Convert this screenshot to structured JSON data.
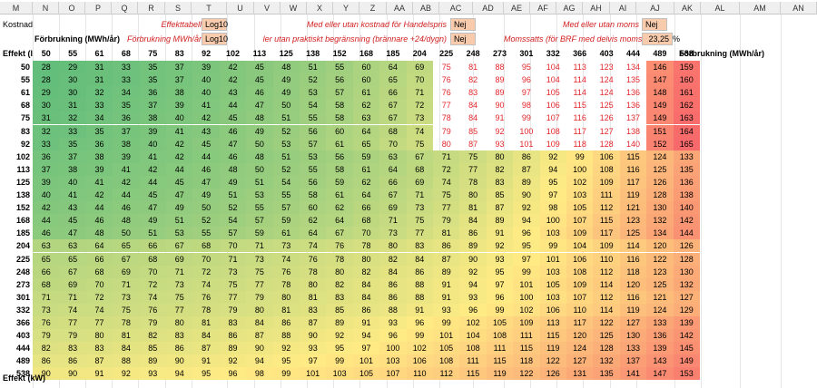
{
  "column_headers": [
    "M",
    "N",
    "O",
    "P",
    "Q",
    "R",
    "S",
    "T",
    "U",
    "V",
    "W",
    "X",
    "Y",
    "Z",
    "AA",
    "AB",
    "AC",
    "AD",
    "AE",
    "AF",
    "AG",
    "AH",
    "AI",
    "AJ",
    "AK",
    "AL",
    "AM",
    "AN"
  ],
  "labels": {
    "kostnad": "Kostnad",
    "forbrukning_bold": "Förbrukning (MWh/år)",
    "forbrukning_red": "Förbrukning MWh/år",
    "effekttabell": "Effekttabell",
    "log10_a": "Log10",
    "log10_b": "Log10",
    "handelspris_label": "Med eller utan kostnad för Handelspris",
    "handelspris_value": "Nej",
    "begransning_label": "ler utan praktiskt begränsning (brännare +24/dygn)",
    "begransning_value": "Nej",
    "moms_label": "Med eller utan moms",
    "moms_value": "Nej",
    "momssats_label": "Momssatts (för BRF med delvis moms)",
    "momssats_value": "23,25",
    "percent": "%",
    "effekt_corner": "Effekt (l",
    "forbrukning_right": "Förbrukning (MWh/år)",
    "effekt_kw": "Effekt (kW)"
  },
  "heatmap": {
    "col_headers": [
      "50",
      "55",
      "61",
      "68",
      "75",
      "83",
      "92",
      "102",
      "113",
      "125",
      "138",
      "152",
      "168",
      "185",
      "204",
      "225",
      "248",
      "273",
      "301",
      "332",
      "366",
      "403",
      "444",
      "489",
      "538"
    ],
    "row_headers": [
      "50",
      "55",
      "61",
      "68",
      "75",
      "83",
      "92",
      "102",
      "113",
      "125",
      "138",
      "152",
      "168",
      "185",
      "204",
      "225",
      "248",
      "273",
      "301",
      "332",
      "366",
      "403",
      "444",
      "489",
      "538"
    ],
    "rows": [
      [
        "28",
        "29",
        "31",
        "33",
        "35",
        "37",
        "39",
        "42",
        "45",
        "48",
        "51",
        "55",
        "60",
        "64",
        "69",
        "75",
        "81",
        "88",
        "95",
        "104",
        "113",
        "123",
        "134",
        "146",
        "159"
      ],
      [
        "28",
        "30",
        "31",
        "33",
        "35",
        "37",
        "40",
        "42",
        "45",
        "49",
        "52",
        "56",
        "60",
        "65",
        "70",
        "76",
        "82",
        "89",
        "96",
        "104",
        "114",
        "124",
        "135",
        "147",
        "160"
      ],
      [
        "29",
        "30",
        "32",
        "34",
        "36",
        "38",
        "40",
        "43",
        "46",
        "49",
        "53",
        "57",
        "61",
        "66",
        "71",
        "76",
        "83",
        "89",
        "97",
        "105",
        "114",
        "124",
        "136",
        "148",
        "161"
      ],
      [
        "30",
        "31",
        "33",
        "35",
        "37",
        "39",
        "41",
        "44",
        "47",
        "50",
        "54",
        "58",
        "62",
        "67",
        "72",
        "77",
        "84",
        "90",
        "98",
        "106",
        "115",
        "125",
        "136",
        "149",
        "162"
      ],
      [
        "31",
        "32",
        "34",
        "36",
        "38",
        "40",
        "42",
        "45",
        "48",
        "51",
        "55",
        "58",
        "63",
        "67",
        "73",
        "78",
        "84",
        "91",
        "99",
        "107",
        "116",
        "126",
        "137",
        "149",
        "163"
      ],
      [
        "32",
        "33",
        "35",
        "37",
        "39",
        "41",
        "43",
        "46",
        "49",
        "52",
        "56",
        "60",
        "64",
        "68",
        "74",
        "79",
        "85",
        "92",
        "100",
        "108",
        "117",
        "127",
        "138",
        "151",
        "164"
      ],
      [
        "33",
        "35",
        "36",
        "38",
        "40",
        "42",
        "45",
        "47",
        "50",
        "53",
        "57",
        "61",
        "65",
        "70",
        "75",
        "80",
        "87",
        "93",
        "101",
        "109",
        "118",
        "128",
        "140",
        "152",
        "165"
      ],
      [
        "36",
        "37",
        "38",
        "39",
        "41",
        "42",
        "44",
        "46",
        "48",
        "51",
        "53",
        "56",
        "59",
        "63",
        "67",
        "71",
        "75",
        "80",
        "86",
        "92",
        "99",
        "106",
        "115",
        "124",
        "133"
      ],
      [
        "37",
        "38",
        "39",
        "41",
        "42",
        "44",
        "46",
        "48",
        "50",
        "52",
        "55",
        "58",
        "61",
        "64",
        "68",
        "72",
        "77",
        "82",
        "87",
        "94",
        "100",
        "108",
        "116",
        "125",
        "135"
      ],
      [
        "39",
        "40",
        "41",
        "42",
        "44",
        "45",
        "47",
        "49",
        "51",
        "54",
        "56",
        "59",
        "62",
        "66",
        "69",
        "74",
        "78",
        "83",
        "89",
        "95",
        "102",
        "109",
        "117",
        "126",
        "136"
      ],
      [
        "40",
        "41",
        "42",
        "44",
        "45",
        "47",
        "49",
        "51",
        "53",
        "55",
        "58",
        "61",
        "64",
        "67",
        "71",
        "75",
        "80",
        "85",
        "90",
        "97",
        "103",
        "111",
        "119",
        "128",
        "138"
      ],
      [
        "42",
        "43",
        "44",
        "46",
        "47",
        "49",
        "50",
        "52",
        "55",
        "57",
        "60",
        "62",
        "66",
        "69",
        "73",
        "77",
        "81",
        "87",
        "92",
        "98",
        "105",
        "112",
        "121",
        "130",
        "140"
      ],
      [
        "44",
        "45",
        "46",
        "48",
        "49",
        "51",
        "52",
        "54",
        "57",
        "59",
        "62",
        "64",
        "68",
        "71",
        "75",
        "79",
        "84",
        "89",
        "94",
        "100",
        "107",
        "115",
        "123",
        "132",
        "142"
      ],
      [
        "46",
        "47",
        "48",
        "50",
        "51",
        "53",
        "55",
        "57",
        "59",
        "61",
        "64",
        "67",
        "70",
        "73",
        "77",
        "81",
        "86",
        "91",
        "96",
        "103",
        "109",
        "117",
        "125",
        "134",
        "144"
      ],
      [
        "63",
        "63",
        "64",
        "65",
        "66",
        "67",
        "68",
        "70",
        "71",
        "73",
        "74",
        "76",
        "78",
        "80",
        "83",
        "86",
        "89",
        "92",
        "95",
        "99",
        "104",
        "109",
        "114",
        "120",
        "126"
      ],
      [
        "65",
        "65",
        "66",
        "67",
        "68",
        "69",
        "70",
        "71",
        "73",
        "74",
        "76",
        "78",
        "80",
        "82",
        "84",
        "87",
        "90",
        "93",
        "97",
        "101",
        "106",
        "110",
        "116",
        "122",
        "128"
      ],
      [
        "66",
        "67",
        "68",
        "69",
        "70",
        "71",
        "72",
        "73",
        "75",
        "76",
        "78",
        "80",
        "82",
        "84",
        "86",
        "89",
        "92",
        "95",
        "99",
        "103",
        "108",
        "112",
        "118",
        "123",
        "130"
      ],
      [
        "68",
        "69",
        "70",
        "71",
        "72",
        "73",
        "74",
        "75",
        "77",
        "78",
        "80",
        "82",
        "84",
        "86",
        "88",
        "91",
        "94",
        "97",
        "101",
        "105",
        "109",
        "114",
        "120",
        "125",
        "132"
      ],
      [
        "71",
        "71",
        "72",
        "73",
        "74",
        "75",
        "76",
        "77",
        "79",
        "80",
        "81",
        "83",
        "84",
        "86",
        "88",
        "91",
        "93",
        "96",
        "100",
        "103",
        "107",
        "112",
        "116",
        "121",
        "127"
      ],
      [
        "73",
        "74",
        "74",
        "75",
        "76",
        "77",
        "78",
        "79",
        "80",
        "81",
        "83",
        "85",
        "86",
        "88",
        "91",
        "93",
        "96",
        "99",
        "102",
        "106",
        "110",
        "114",
        "119",
        "124",
        "129"
      ],
      [
        "76",
        "77",
        "77",
        "78",
        "79",
        "80",
        "81",
        "83",
        "84",
        "86",
        "87",
        "89",
        "91",
        "93",
        "96",
        "99",
        "102",
        "105",
        "109",
        "113",
        "117",
        "122",
        "127",
        "133",
        "139"
      ],
      [
        "79",
        "79",
        "80",
        "81",
        "82",
        "83",
        "84",
        "86",
        "87",
        "88",
        "90",
        "92",
        "94",
        "96",
        "99",
        "101",
        "104",
        "108",
        "111",
        "115",
        "120",
        "125",
        "130",
        "136",
        "142"
      ],
      [
        "82",
        "83",
        "83",
        "84",
        "85",
        "86",
        "87",
        "89",
        "90",
        "92",
        "93",
        "95",
        "97",
        "100",
        "102",
        "105",
        "108",
        "111",
        "115",
        "119",
        "124",
        "128",
        "133",
        "139",
        "145"
      ],
      [
        "86",
        "86",
        "87",
        "88",
        "89",
        "90",
        "91",
        "92",
        "94",
        "95",
        "97",
        "99",
        "101",
        "103",
        "106",
        "108",
        "111",
        "115",
        "118",
        "122",
        "127",
        "132",
        "137",
        "143",
        "149"
      ],
      [
        "90",
        "90",
        "91",
        "92",
        "93",
        "94",
        "95",
        "96",
        "98",
        "99",
        "101",
        "103",
        "105",
        "107",
        "110",
        "112",
        "115",
        "119",
        "122",
        "126",
        "131",
        "135",
        "141",
        "147",
        "153"
      ]
    ]
  }
}
